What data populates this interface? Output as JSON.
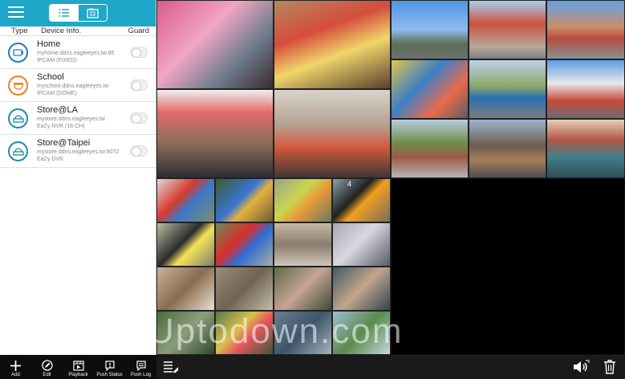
{
  "header": {
    "menu_icon": "hamburger-menu-icon",
    "tabs": [
      {
        "icon": "list-view-icon",
        "active": true
      },
      {
        "icon": "camera-album-icon",
        "active": false
      }
    ]
  },
  "columns": {
    "type": "Type",
    "device_info": "Device Info.",
    "guard": "Guard"
  },
  "devices": [
    {
      "name": "Home",
      "host": "myhome.ddns.eagleeyes.tw:85",
      "model": "IPCAM (FIXED)",
      "icon": "ipcam-fixed-icon",
      "color": "#1b7fc4"
    },
    {
      "name": "School",
      "host": "myschool.ddns.eagleeyes.tw",
      "model": "IPCAM (DOME)",
      "icon": "ipcam-dome-icon",
      "color": "#e8812a"
    },
    {
      "name": "Store@LA",
      "host": "mystore.ddns.eagleeyes.tw",
      "model": "EaZy NVR (16 CH)",
      "icon": "nvr-icon",
      "color": "#1a8fa8"
    },
    {
      "name": "Store@Taipei",
      "host": "mystore.ddns.eagleeyes.tw:8072",
      "model": "EaZy DVR",
      "icon": "dvr-icon",
      "color": "#1a8fa8"
    }
  ],
  "bottom_toolbar": [
    {
      "label": "Add",
      "icon": "plus-icon"
    },
    {
      "label": "Edit",
      "icon": "pencil-icon"
    },
    {
      "label": "Playback",
      "icon": "playback-icon"
    },
    {
      "label": "Push Status",
      "icon": "alert-bubble-icon"
    },
    {
      "label": "Push Log",
      "icon": "log-bubble-icon"
    }
  ],
  "video": {
    "channel_label": "4",
    "watermark": "Uptodown.com",
    "colors": {
      "tiles": [
        "#c94c7b",
        "#b9573f",
        "#8a9aa7",
        "#9c4c3e",
        "#c9a38f",
        "#c7c7c9",
        "#6f7c5a",
        "#a3b4c0",
        "#5a6f85",
        "#4d6b8f",
        "#9b7256",
        "#b95a48"
      ]
    }
  },
  "right_toolbar": {
    "layout_icon": "layout-switch-icon",
    "volume_icon": "speaker-icon",
    "delete_icon": "trash-icon"
  }
}
